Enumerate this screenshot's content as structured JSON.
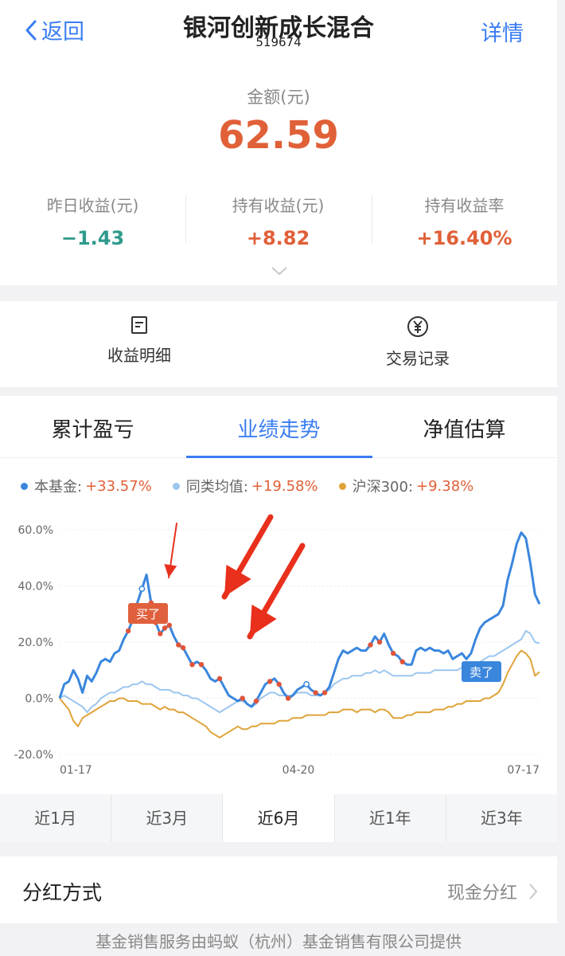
{
  "header": {
    "back_label": "返回",
    "title": "银河创新成长混合",
    "code": "519674",
    "detail_label": "详情"
  },
  "amount": {
    "label": "金额(元)",
    "value": "62.59"
  },
  "stats": [
    {
      "label": "昨日收益(元)",
      "value": "−1.43",
      "color": "#2f9a8c"
    },
    {
      "label": "持有收益(元)",
      "value": "+8.82",
      "color": "#e06038"
    },
    {
      "label": "持有收益率",
      "value": "+16.40%",
      "color": "#e06038"
    }
  ],
  "actions": [
    {
      "label": "收益明细",
      "icon": "document-icon"
    },
    {
      "label": "交易记录",
      "icon": "yuan-circle-icon"
    }
  ],
  "tabs": [
    {
      "label": "累计盈亏"
    },
    {
      "label": "业绩走势",
      "active": true
    },
    {
      "label": "净值估算"
    }
  ],
  "legend": [
    {
      "name": "本基金:",
      "value": "+33.57%",
      "color": "#3a86dd"
    },
    {
      "name": "同类均值:",
      "value": "+19.58%",
      "color": "#9cc6ee"
    },
    {
      "name": "沪深300:",
      "value": "+9.38%",
      "color": "#dfa33a"
    }
  ],
  "chart_data": {
    "type": "line",
    "ylim": [
      -20,
      60
    ],
    "y_ticks": [
      "60.0%",
      "40.0%",
      "20.0%",
      "0.0%",
      "-20.0%"
    ],
    "x_ticks": [
      "01-17",
      "04-20",
      "07-17"
    ],
    "grid": true,
    "series": [
      {
        "name": "本基金",
        "color": "#3a86dd",
        "values": [
          0,
          5,
          6,
          10,
          7,
          2,
          8,
          6,
          9,
          13,
          14,
          13,
          16,
          17,
          21,
          24,
          28,
          34,
          39,
          44,
          34,
          27,
          23,
          25,
          26,
          22,
          19,
          18,
          15,
          12,
          13,
          12,
          10,
          7,
          6,
          7,
          4,
          1,
          0,
          -1,
          0,
          -2,
          -3,
          -1,
          2,
          5,
          6,
          7,
          5,
          2,
          0,
          1,
          3,
          4,
          5,
          3,
          2,
          1,
          2,
          4,
          9,
          14,
          17,
          16,
          17,
          18,
          17,
          17,
          19,
          22,
          20,
          23,
          19,
          16,
          15,
          13,
          12,
          12,
          17,
          18,
          17,
          18,
          17,
          17,
          16,
          17,
          14,
          15,
          16,
          14,
          16,
          21,
          25,
          27,
          28,
          29,
          30,
          33,
          42,
          48,
          55,
          59,
          57,
          48,
          37,
          33.57
        ],
        "buy_label": "买了",
        "sell_label": "卖了"
      },
      {
        "name": "同类均值",
        "color": "#9cc6ee",
        "values": [
          0,
          1,
          0,
          -1,
          -2,
          -3,
          -5,
          -3,
          -2,
          0,
          1,
          2,
          2,
          3,
          4,
          4,
          5,
          5,
          6,
          5,
          5,
          4,
          3,
          3,
          3,
          2,
          2,
          1,
          1,
          0,
          0,
          -1,
          -2,
          -3,
          -4,
          -5,
          -4,
          -3,
          -2,
          -1,
          -1,
          -2,
          -3,
          -2,
          0,
          1,
          2,
          2,
          1,
          1,
          1,
          1,
          2,
          2,
          2,
          1,
          1,
          1,
          2,
          3,
          5,
          6,
          7,
          7,
          8,
          8,
          8,
          9,
          9,
          10,
          9,
          10,
          9,
          8,
          8,
          8,
          8,
          8,
          9,
          9,
          9,
          9,
          10,
          10,
          10,
          10,
          10,
          10,
          11,
          11,
          11,
          12,
          13,
          14,
          15,
          15,
          16,
          17,
          18,
          19,
          20,
          21,
          24,
          23,
          20,
          19.58
        ]
      },
      {
        "name": "沪深300",
        "color": "#dfa33a",
        "values": [
          0,
          -2,
          -4,
          -8,
          -10,
          -7,
          -6,
          -5,
          -4,
          -3,
          -2,
          -1,
          -1,
          0,
          0,
          -1,
          -1,
          -1,
          -2,
          -2,
          -2,
          -3,
          -4,
          -3,
          -4,
          -4,
          -5,
          -5,
          -6,
          -7,
          -8,
          -9,
          -10,
          -12,
          -13,
          -14,
          -13,
          -12,
          -11,
          -10,
          -11,
          -11,
          -10,
          -10,
          -9,
          -9,
          -9,
          -9,
          -8,
          -8,
          -8,
          -7,
          -7,
          -7,
          -6,
          -6,
          -6,
          -6,
          -6,
          -5,
          -5,
          -5,
          -4,
          -4,
          -4,
          -5,
          -4,
          -4,
          -4,
          -5,
          -4,
          -4,
          -5,
          -7,
          -7,
          -7,
          -6,
          -6,
          -5,
          -5,
          -5,
          -5,
          -4,
          -4,
          -4,
          -3,
          -3,
          -2,
          -2,
          -1,
          -1,
          -1,
          -1,
          0,
          0,
          1,
          2,
          5,
          9,
          12,
          15,
          17,
          16,
          14,
          8,
          9.38
        ]
      }
    ]
  },
  "periods": [
    {
      "label": "近1月"
    },
    {
      "label": "近3月"
    },
    {
      "label": "近6月",
      "active": true
    },
    {
      "label": "近1年"
    },
    {
      "label": "近3年"
    }
  ],
  "dividend": {
    "label": "分红方式",
    "value": "现金分红"
  },
  "footer": "基金销售服务由蚂蚁（杭州）基金销售有限公司提供"
}
